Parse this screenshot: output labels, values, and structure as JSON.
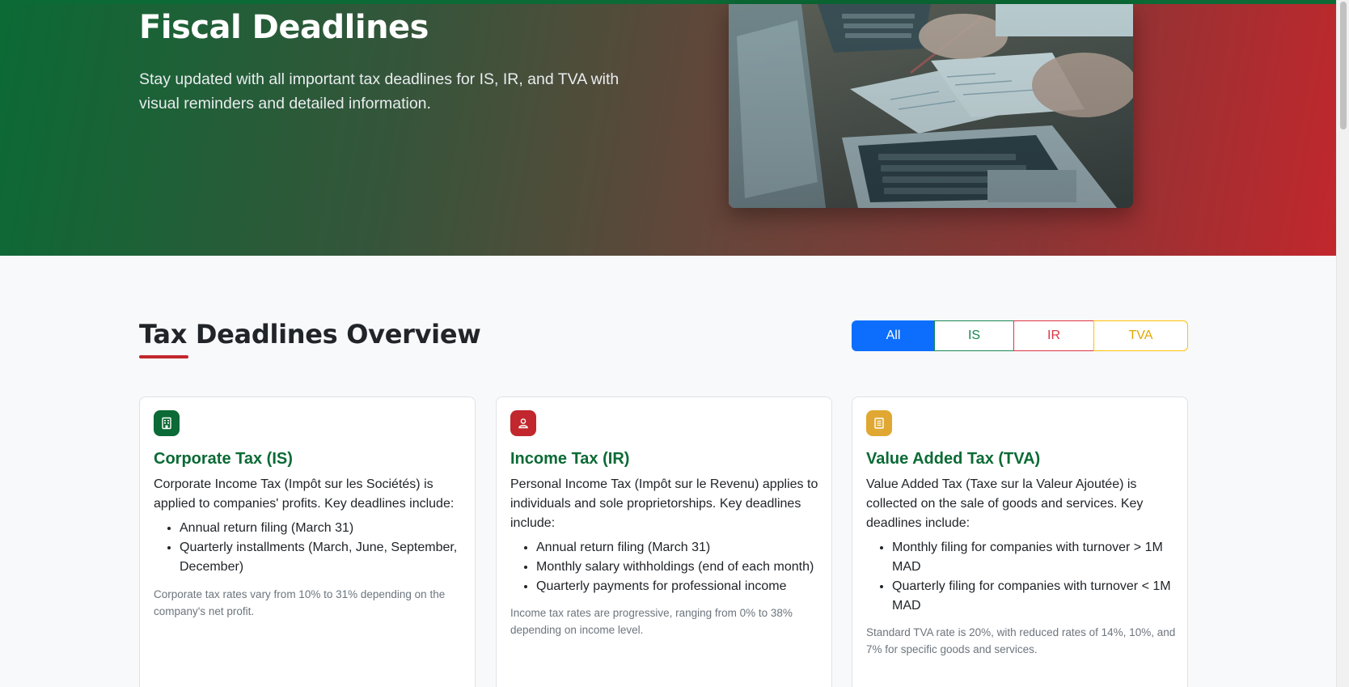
{
  "hero": {
    "title": "Fiscal Deadlines",
    "subtitle": "Stay updated with all important tax deadlines for IS, IR, and TVA with visual reminders and detailed information."
  },
  "overview": {
    "title": "Tax Deadlines Overview",
    "filters": [
      "All",
      "IS",
      "IR",
      "TVA"
    ],
    "active_filter": "All"
  },
  "cards": [
    {
      "icon": "building-icon",
      "title": "Corporate Tax (IS)",
      "description": "Corporate Income Tax (Impôt sur les Sociétés) is applied to companies' profits. Key deadlines include:",
      "items": [
        "Annual return filing (March 31)",
        "Quarterly installments (March, June, September, December)"
      ],
      "note": "Corporate tax rates vary from 10% to 31% depending on the company's net profit."
    },
    {
      "icon": "person-icon",
      "title": "Income Tax (IR)",
      "description": "Personal Income Tax (Impôt sur le Revenu) applies to individuals and sole proprietorships. Key deadlines include:",
      "items": [
        "Annual return filing (March 31)",
        "Monthly salary withholdings (end of each month)",
        "Quarterly payments for professional income"
      ],
      "note": "Income tax rates are progressive, ranging from 0% to 38% depending on income level."
    },
    {
      "icon": "receipt-icon",
      "title": "Value Added Tax (TVA)",
      "description": "Value Added Tax (Taxe sur la Valeur Ajoutée) is collected on the sale of goods and services. Key deadlines include:",
      "items": [
        "Monthly filing for companies with turnover > 1M MAD",
        "Quarterly filing for companies with turnover < 1M MAD"
      ],
      "note": "Standard TVA rate is 20%, with reduced rates of 14%, 10%, and 7% for specific goods and services."
    }
  ],
  "colors": {
    "brand_green": "#0b6a35",
    "brand_red": "#c1272d",
    "accent_yellow": "#e0a832",
    "filter_blue": "#0d6efd"
  }
}
